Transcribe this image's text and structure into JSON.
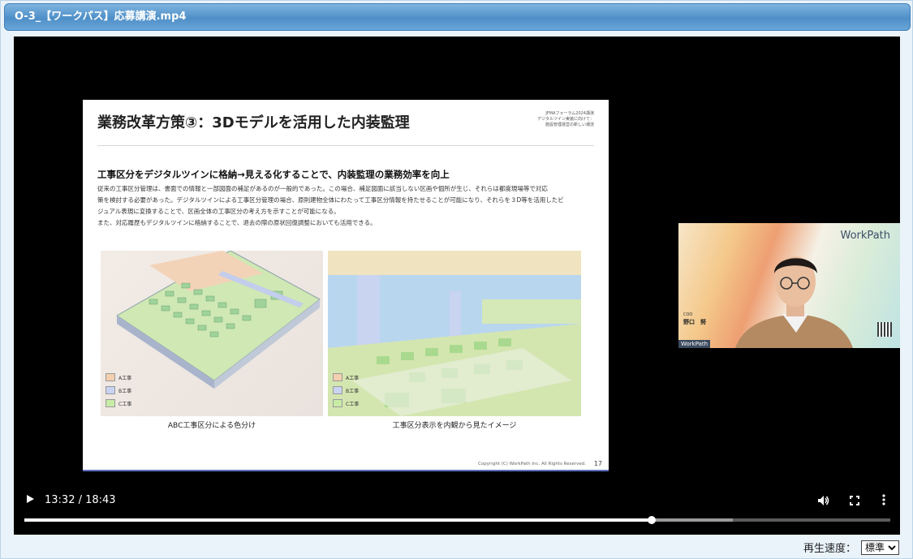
{
  "window": {
    "title": "O-3_【ワークパス】応募講演.mp4"
  },
  "slide": {
    "title": "業務改革方策③：3Dモデルを活用した内装監理",
    "topright": [
      "JFMAフォーラム2024講演",
      "デジタルツイン実装に向けて：",
      "施設管理運営の新しい潮流"
    ],
    "subtitle": "工事区分をデジタルツインに格納→見える化することで、内装監理の業務効率を向上",
    "body": [
      "従来の工事区分管理は、書面での情報と一部図面の補足があるのが一般的であった。この場合、補足図面に該当しない区画や個所が生じ、それらは都度現場等で対応",
      "策を検討する必要があった。デジタルツインによる工事区分管理の場合、原則建物全体にわたって工事区分情報を持たせることが可能になり、それらを３D等を活用したビ",
      "ジュアル表現に変換することで、区画全体の工事区分の考え方を示すことが可能になる。",
      "また、対応履歴もデジタルツインに格納することで、退去の際の原状回復調整においても活用できる。"
    ],
    "legend": [
      "A工事",
      "B工事",
      "C工事"
    ],
    "legend_colors": [
      "#f4cfb0",
      "#c9d3f2",
      "#c8eba6"
    ],
    "captions": [
      "ABC工事区分による色分け",
      "工事区分表示を内観から見たイメージ"
    ],
    "copyright": "Copyright (C) WorkPath Inc. All Rights Reserved.",
    "page": "17"
  },
  "webcam": {
    "logo": "WorkPath",
    "role": "COO",
    "name": "野口　努",
    "tag": "WorkPath"
  },
  "player": {
    "time": "13:32 / 18:43",
    "progress_played": 0.724,
    "progress_buffered": 0.818
  },
  "speed": {
    "label": "再生速度：",
    "selected": "標準"
  }
}
